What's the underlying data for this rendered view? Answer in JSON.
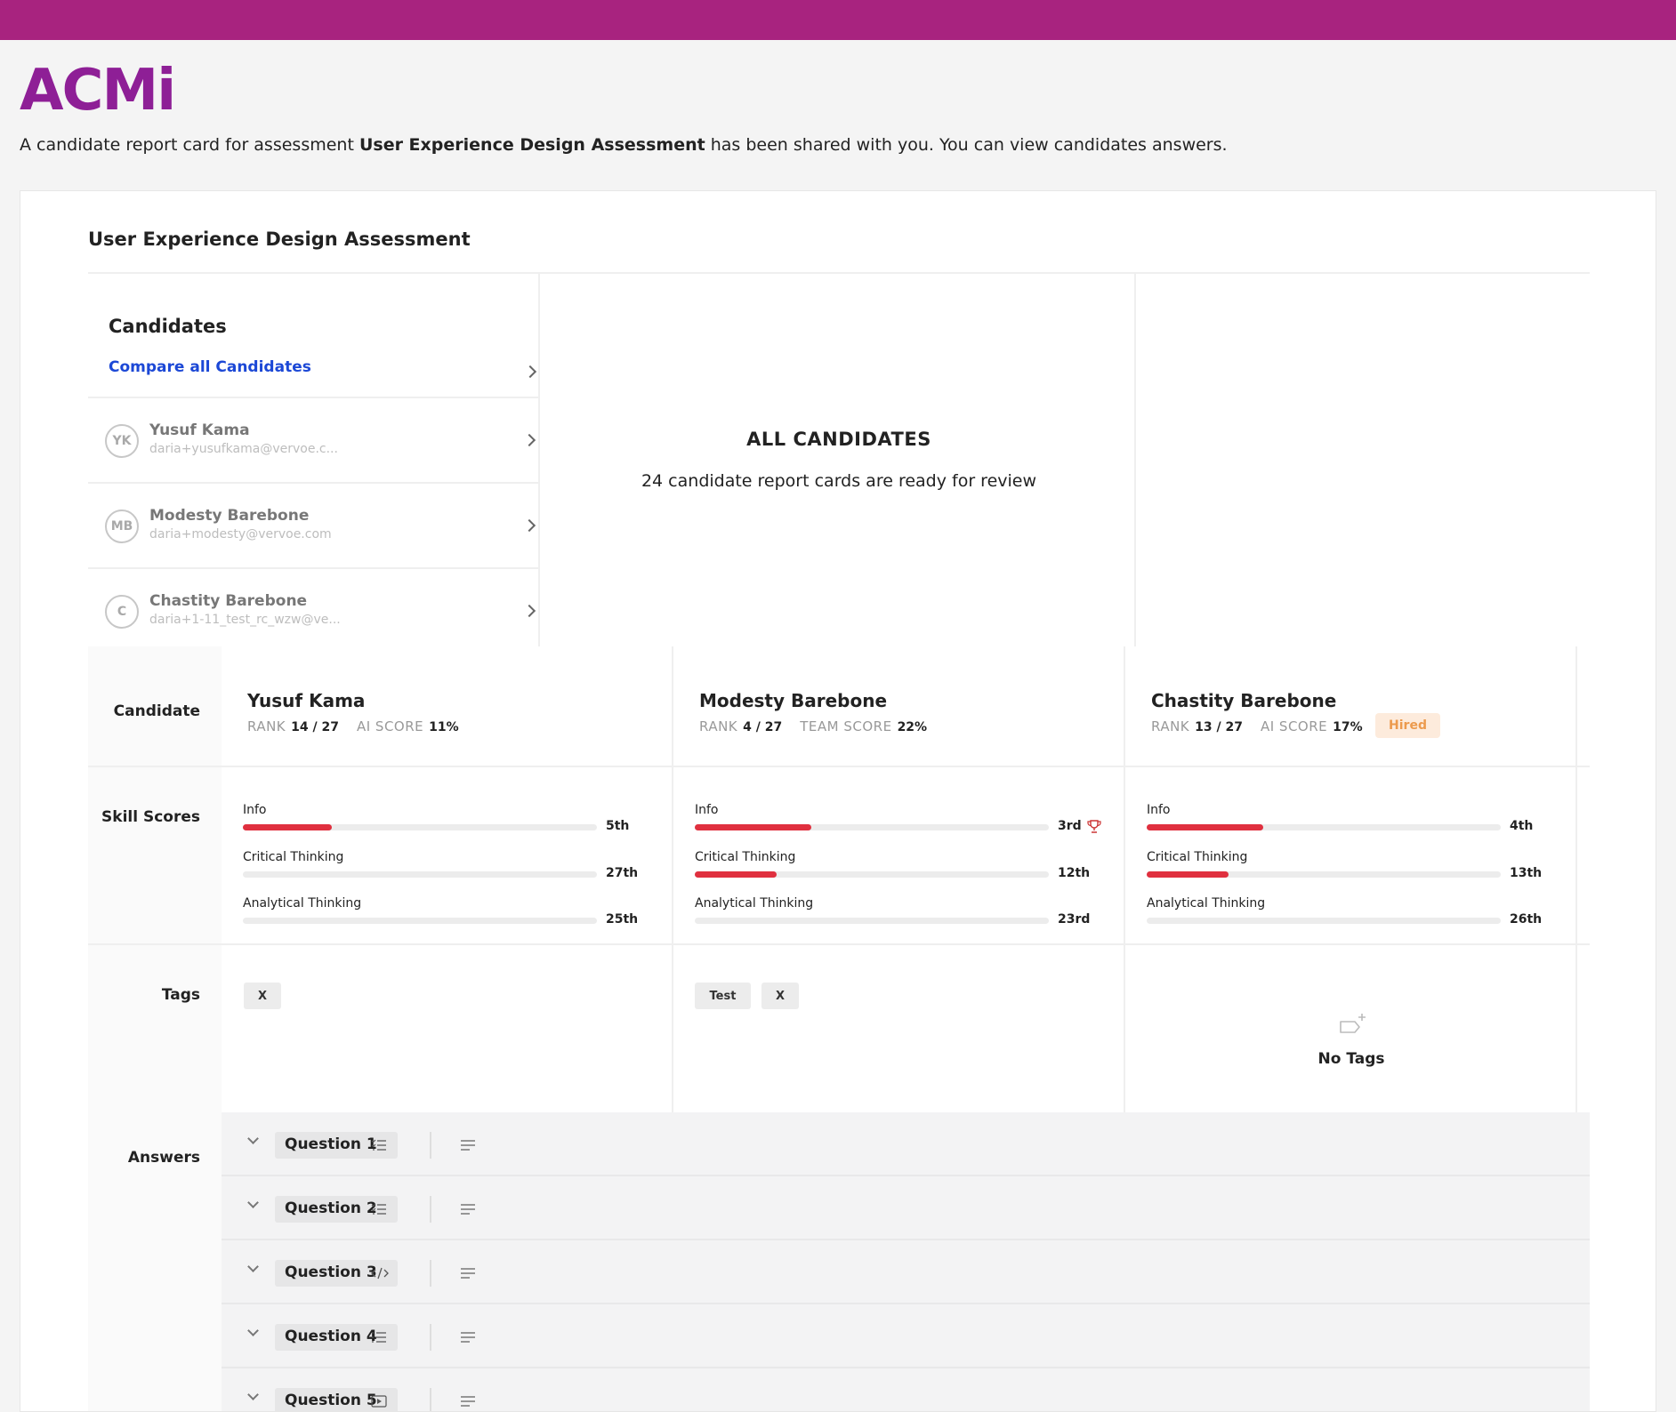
{
  "brand": {
    "logo_text": "ACMi",
    "topbar_color": "#a8237f",
    "logo_color": "#8e1f96"
  },
  "intro": {
    "before": "A candidate report card for assessment ",
    "assessment": "User Experience Design Assessment",
    "after": " has been shared with you. You can view candidates answers."
  },
  "assessment_title": "User Experience Design Assessment",
  "candidates_panel": {
    "heading": "Candidates",
    "compare_label": "Compare all Candidates",
    "items": [
      {
        "initials": "YK",
        "name": "Yusuf Kama",
        "email": "daria+yusufkama@vervoe.c..."
      },
      {
        "initials": "MB",
        "name": "Modesty Barebone",
        "email": "daria+modesty@vervoe.com"
      },
      {
        "initials": "C",
        "name": "Chastity Barebone",
        "email": "daria+1-11_test_rc_wzw@ve..."
      }
    ]
  },
  "all_candidates": {
    "title": "ALL CANDIDATES",
    "subtitle": "24 candidate report cards are ready for review"
  },
  "row_labels": {
    "candidate": "Candidate",
    "skill_scores": "Skill Scores",
    "tags": "Tags",
    "answers": "Answers"
  },
  "rank_label": "RANK",
  "columns": [
    {
      "name": "Yusuf Kama",
      "rank": "14 / 27",
      "score_label": "AI SCORE",
      "score": "11%",
      "skills": [
        {
          "name": "Info",
          "rank": "5th",
          "level": 0.25
        },
        {
          "name": "Critical Thinking",
          "rank": "27th",
          "level": 0.0
        },
        {
          "name": "Analytical Thinking",
          "rank": "25th",
          "level": 0.0
        }
      ],
      "tags": [
        "X"
      ]
    },
    {
      "name": "Modesty Barebone",
      "rank": "4 / 27",
      "score_label": "TEAM SCORE",
      "score": "22%",
      "skills": [
        {
          "name": "Info",
          "rank": "3rd",
          "level": 0.33,
          "trophy": true
        },
        {
          "name": "Critical Thinking",
          "rank": "12th",
          "level": 0.23
        },
        {
          "name": "Analytical Thinking",
          "rank": "23rd",
          "level": 0.0
        }
      ],
      "tags": [
        "Test",
        "X"
      ]
    },
    {
      "name": "Chastity Barebone",
      "rank": "13 / 27",
      "score_label": "AI SCORE",
      "score": "17%",
      "status": "Hired",
      "skills": [
        {
          "name": "Info",
          "rank": "4th",
          "level": 0.33
        },
        {
          "name": "Critical Thinking",
          "rank": "13th",
          "level": 0.23
        },
        {
          "name": "Analytical Thinking",
          "rank": "26th",
          "level": 0.0
        }
      ],
      "tags": [],
      "no_tags_label": "No Tags"
    }
  ],
  "questions": [
    {
      "label": "Question 1",
      "icon": "list-check-icon"
    },
    {
      "label": "Question 2",
      "icon": "list-check-icon"
    },
    {
      "label": "Question 3",
      "icon": "code-icon"
    },
    {
      "label": "Question 4",
      "icon": "list-icon"
    },
    {
      "label": "Question 5",
      "icon": "video-icon"
    }
  ],
  "colors": {
    "skill_fill": "#e0303f",
    "link": "#1c48d6",
    "hired_bg": "#fdebdc",
    "hired_text": "#ec9a4d"
  }
}
